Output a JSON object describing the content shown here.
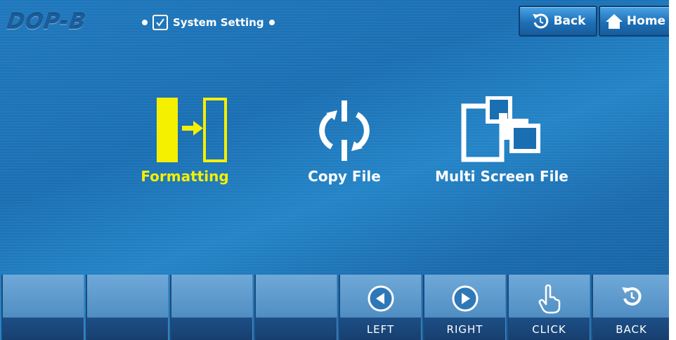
{
  "header": {
    "logo": "DOP-B",
    "title": "System Setting",
    "back_label": "Back",
    "home_label": "Home"
  },
  "menu": {
    "items": [
      {
        "label": "Formatting",
        "icon": "format-icon",
        "active": true
      },
      {
        "label": "Copy File",
        "icon": "copy-file-icon",
        "active": false
      },
      {
        "label": "Multi Screen File",
        "icon": "multi-screen-file-icon",
        "active": false
      }
    ]
  },
  "bottom_bar": {
    "buttons": [
      {
        "label": "",
        "icon": null
      },
      {
        "label": "",
        "icon": null
      },
      {
        "label": "",
        "icon": null
      },
      {
        "label": "",
        "icon": null
      },
      {
        "label": "LEFT",
        "icon": "arrow-left-circle-icon"
      },
      {
        "label": "RIGHT",
        "icon": "arrow-right-circle-icon"
      },
      {
        "label": "CLICK",
        "icon": "pointer-hand-icon"
      },
      {
        "label": "BACK",
        "icon": "back-arrow-icon"
      }
    ]
  },
  "colors": {
    "background": "#1a6fb3",
    "highlight": "#f4f000",
    "text": "#ffffff"
  }
}
